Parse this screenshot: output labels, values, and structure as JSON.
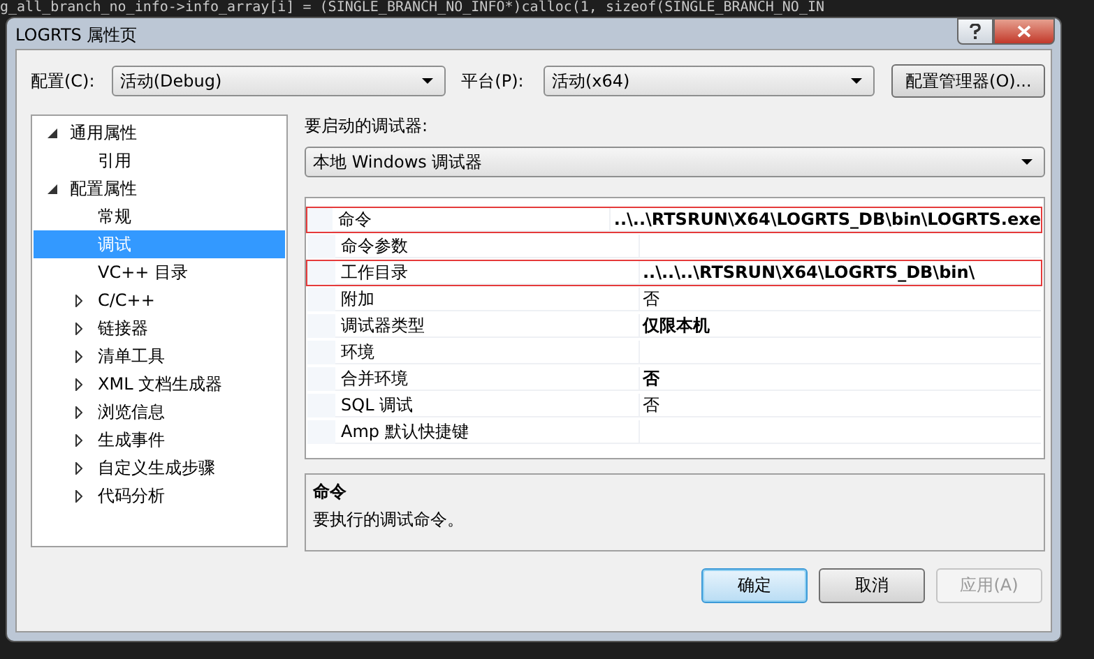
{
  "background_code": "g_all_branch_no_info->info_array[i] = (SINGLE_BRANCH_NO_INFO*)calloc(1, sizeof(SINGLE_BRANCH_NO_IN",
  "window": {
    "title": "LOGRTS 属性页"
  },
  "config": {
    "label": "配置(C):",
    "value": "活动(Debug)"
  },
  "platform": {
    "label": "平台(P):",
    "value": "活动(x64)"
  },
  "config_manager_button": "配置管理器(O)...",
  "tree": [
    {
      "label": "通用属性",
      "expanded": true,
      "selected": false,
      "children": [
        {
          "label": "引用",
          "selected": false
        }
      ]
    },
    {
      "label": "配置属性",
      "expanded": true,
      "selected": false,
      "children": [
        {
          "label": "常规",
          "selected": false
        },
        {
          "label": "调试",
          "selected": true
        },
        {
          "label": "VC++ 目录",
          "selected": false
        },
        {
          "label": "C/C++",
          "expanded": false,
          "selected": false
        },
        {
          "label": "链接器",
          "expanded": false,
          "selected": false
        },
        {
          "label": "清单工具",
          "expanded": false,
          "selected": false
        },
        {
          "label": "XML 文档生成器",
          "expanded": false,
          "selected": false
        },
        {
          "label": "浏览信息",
          "expanded": false,
          "selected": false
        },
        {
          "label": "生成事件",
          "expanded": false,
          "selected": false
        },
        {
          "label": "自定义生成步骤",
          "expanded": false,
          "selected": false
        },
        {
          "label": "代码分析",
          "expanded": false,
          "selected": false
        }
      ]
    }
  ],
  "debugger": {
    "label": "要启动的调试器:",
    "value": "本地 Windows 调试器"
  },
  "properties": [
    {
      "name": "命令",
      "value": "..\\..\\RTSRUN\\X64\\LOGRTS_DB\\bin\\LOGRTS.exe",
      "modified": true,
      "highlighted": true
    },
    {
      "name": "命令参数",
      "highlighted": false
    },
    {
      "name": "工作目录",
      "value": "..\\..\\..\\RTSRUN\\X64\\LOGRTS_DB\\bin\\",
      "modified": true,
      "highlighted": true
    },
    {
      "name": "附加",
      "value": "否",
      "modified": false,
      "highlighted": false
    },
    {
      "name": "调试器类型",
      "value": "仅限本机",
      "modified": true,
      "highlighted": false
    },
    {
      "name": "环境",
      "highlighted": false
    },
    {
      "name": "合并环境",
      "value": "否",
      "modified": true,
      "highlighted": false
    },
    {
      "name": "SQL 调试",
      "value": "否",
      "modified": false,
      "highlighted": false
    },
    {
      "name": "Amp 默认快捷键",
      "highlighted": false
    }
  ],
  "description": {
    "title": "命令",
    "text": "要执行的调试命令。"
  },
  "buttons": [
    {
      "label": "确定",
      "default": true,
      "disabled": false
    },
    {
      "label": "取消",
      "default": false,
      "disabled": false
    },
    {
      "label": "应用(A)",
      "default": false,
      "disabled": true
    }
  ]
}
